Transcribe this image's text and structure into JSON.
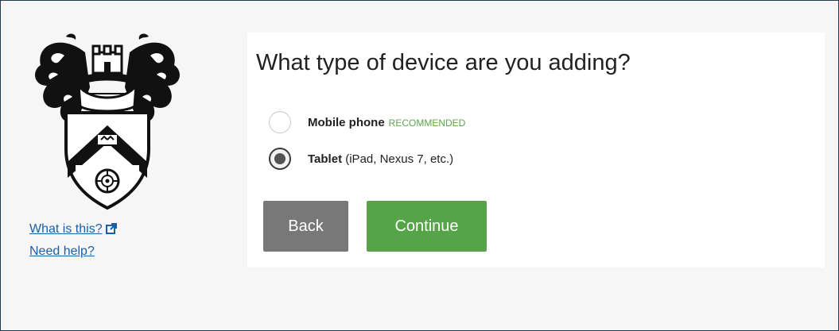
{
  "prompt": {
    "title": "What type of device are you adding?"
  },
  "options": [
    {
      "label": "Mobile phone",
      "badge": "RECOMMENDED",
      "detail": "",
      "selected": false
    },
    {
      "label": "Tablet",
      "badge": "",
      "detail": " (iPad, Nexus 7, etc.)",
      "selected": true
    }
  ],
  "actions": {
    "back_label": "Back",
    "continue_label": "Continue"
  },
  "sidebar": {
    "what_is_this": "What is this?",
    "need_help": "Need help?"
  },
  "colors": {
    "frame_border": "#1f3a4d",
    "background": "#f6f6f6",
    "link": "#1a5fa8",
    "badge": "#5aa84a",
    "back_button": "#787878",
    "continue_button": "#55a548"
  },
  "icons": {
    "logo": "university-crest-logo",
    "external_link": "external-link-icon"
  }
}
